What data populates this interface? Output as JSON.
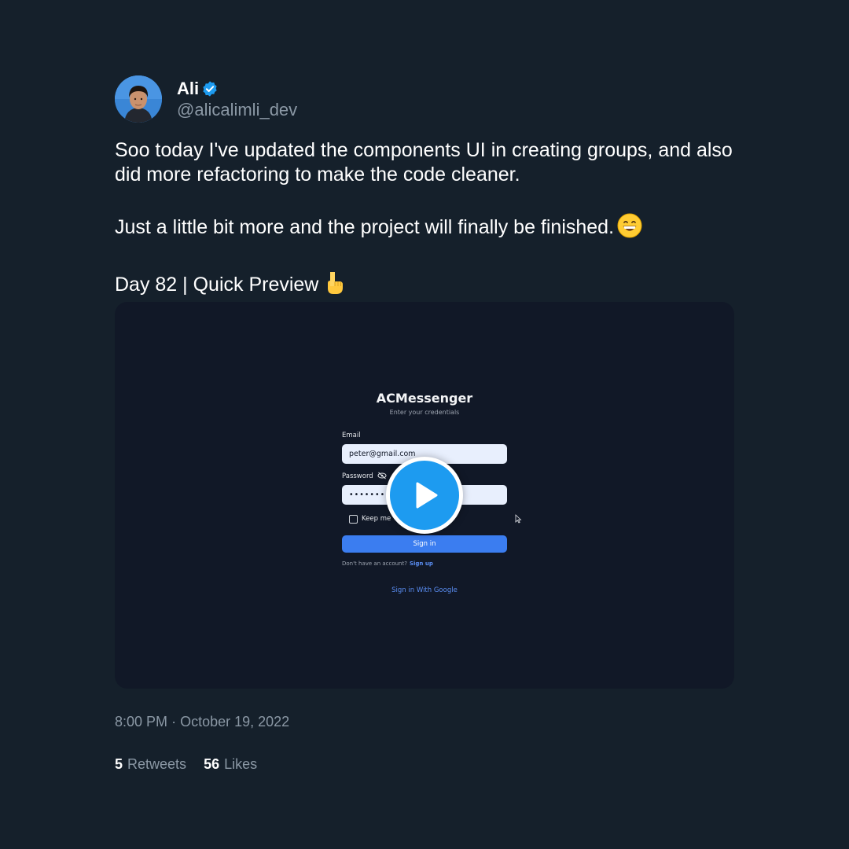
{
  "author": {
    "display_name": "Ali",
    "handle": "@alicalimli_dev",
    "verified": true,
    "avatar_icon": "profile-photo",
    "verified_color": "#1d9bf0"
  },
  "tweet": {
    "paragraph_1": "Soo today I've updated the components UI in creating groups, and also did more refactoring to make the code cleaner.",
    "paragraph_2": "Just a little bit more and the project will finally be finished.",
    "paragraph_2_emoji": "grinning-face-emoji",
    "paragraph_3": "Day 82 | Quick Preview",
    "paragraph_3_emoji": "backhand-index-pointing-down-emoji"
  },
  "media": {
    "type": "video",
    "play_icon": "play-icon",
    "app": {
      "title": "ACMessenger",
      "subtitle": "Enter your credentials",
      "email_label": "Email",
      "email_value": "peter@gmail.com",
      "password_label": "Password",
      "password_value": "•••••••••",
      "keep_signed_in_label": "Keep me",
      "sign_in_button": "Sign in",
      "no_account_text": "Don't have an account?",
      "sign_up_link": "Sign up",
      "google_link": "Sign in With Google",
      "accent_color": "#3b7df0"
    }
  },
  "footer": {
    "time": "8:00 PM",
    "separator": "·",
    "date": "October 19, 2022",
    "retweets_count": "5",
    "retweets_label": "Retweets",
    "likes_count": "56",
    "likes_label": "Likes"
  },
  "colors": {
    "background": "#15202b",
    "muted_text": "#8b98a5",
    "media_background": "#111827"
  }
}
